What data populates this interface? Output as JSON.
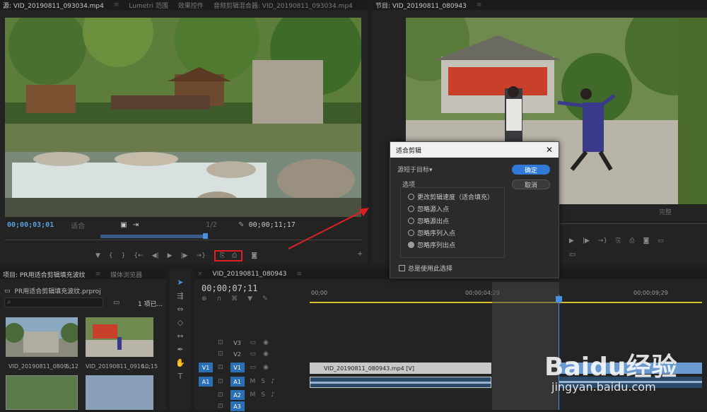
{
  "source_panel": {
    "tabs": [
      "源: VID_20190811_093034.mp4",
      "Lumetri 范围",
      "效果控件",
      "音频剪辑混合器: VID_20190811_093034.mp4"
    ],
    "timecode_in": "00;00;03;01",
    "fit_label": "适合",
    "zoom_label": "1/2",
    "timecode_out": "00;00;11;17"
  },
  "program_panel": {
    "tab": "节目: VID_20190811_080943",
    "quality": "完整"
  },
  "dialog": {
    "title": "适合剪辑",
    "mode": "源短于目标",
    "ok": "确定",
    "cancel": "取消",
    "options_label": "选项",
    "options": [
      "更改剪辑速度（适合填充）",
      "忽略源入点",
      "忽略源出点",
      "忽略序列入点",
      "忽略序列出点"
    ],
    "checkbox": "总是使用此选择"
  },
  "project_panel": {
    "tabs": [
      "项目: PR用适合剪辑填充波纹",
      "媒体浏览器"
    ],
    "project_file": "PR用适合剪辑填充波纹.prproj",
    "item_count": "1 项已...",
    "thumbs": [
      {
        "name": "VID_20190811_0809...",
        "dur": "5;12"
      },
      {
        "name": "VID_20190811_0916...",
        "dur": "10;15"
      }
    ]
  },
  "timeline": {
    "tab": "VID_20190811_080943",
    "timecode": "00;00;07;11",
    "ruler": [
      "00;00",
      "00;00;04;29",
      "00;00;09;29"
    ],
    "tracks": [
      "V3",
      "V2",
      "V1",
      "A1",
      "A2",
      "A3"
    ],
    "src_patch_v": "V1",
    "src_patch_a": "A1",
    "clip_v1": "VID_20190811_080943.mp4 [V]"
  },
  "watermark": {
    "brand": "Baidu经验",
    "url": "jingyan.baidu.com"
  }
}
